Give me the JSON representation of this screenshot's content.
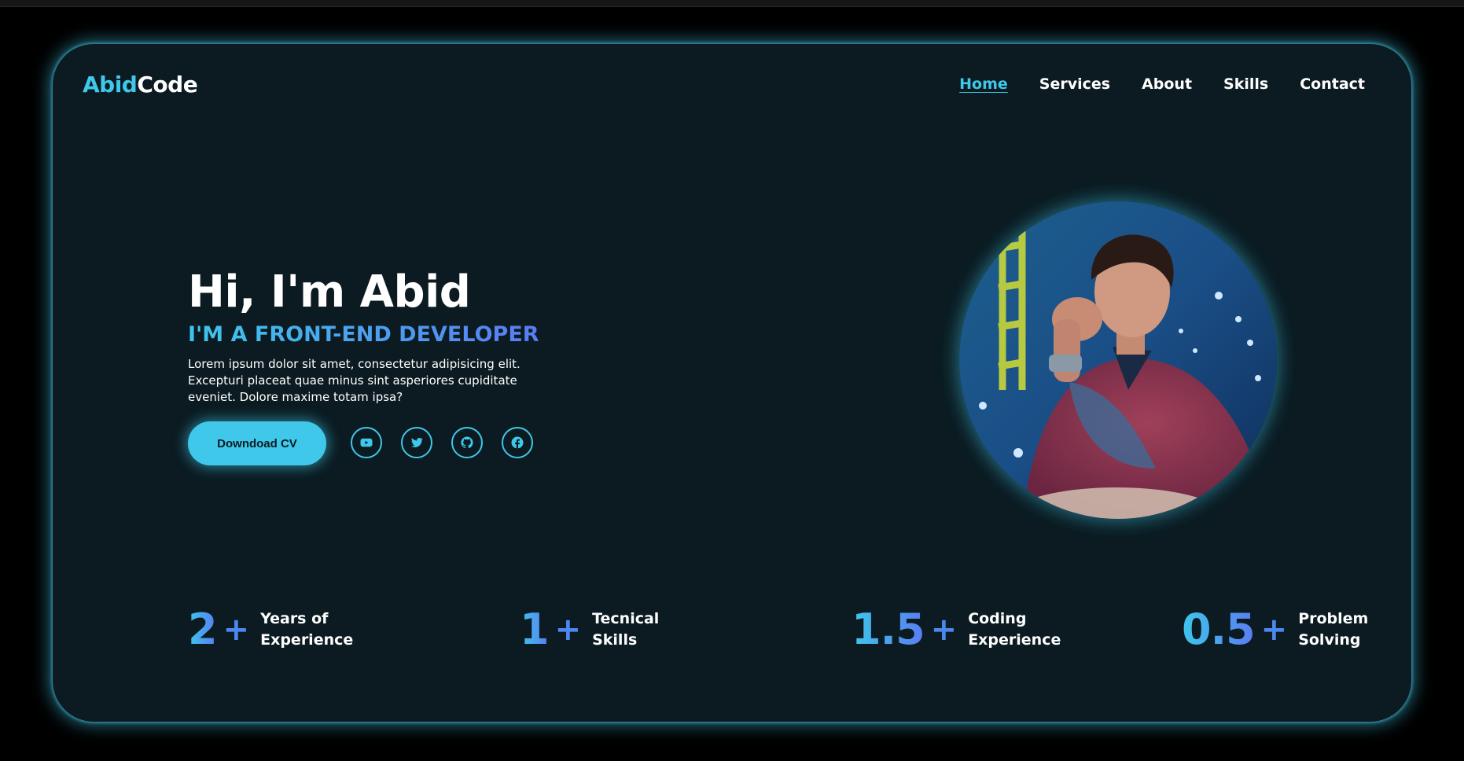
{
  "header": {
    "logo_part1": "Abid",
    "logo_part2": "Code",
    "nav": [
      {
        "label": "Home",
        "active": true
      },
      {
        "label": "Services",
        "active": false
      },
      {
        "label": "About",
        "active": false
      },
      {
        "label": "Skills",
        "active": false
      },
      {
        "label": "Contact",
        "active": false
      }
    ]
  },
  "hero": {
    "title": "Hi, I'm Abid",
    "subtitle": "I'M A FRONT-END DEVELOPER",
    "description": "Lorem ipsum dolor sit amet, consectetur adipisicing elit. Excepturi placeat quae minus sint asperiores cupiditate eveniet. Dolore maxime totam ipsa?",
    "cv_button": "Downdoad CV",
    "socials": [
      "youtube-icon",
      "twitter-icon",
      "github-icon",
      "facebook-icon"
    ]
  },
  "stats": [
    {
      "value": "2",
      "plus": "+",
      "line1": "Years of",
      "line2": "Experience"
    },
    {
      "value": "1",
      "plus": "+",
      "line1": "Tecnical",
      "line2": "Skills"
    },
    {
      "value": "1.5",
      "plus": "+",
      "line1": "Coding",
      "line2": "Experience"
    },
    {
      "value": "0.5",
      "plus": "+",
      "line1": "Problem",
      "line2": "Solving"
    }
  ],
  "colors": {
    "accent": "#3fc8ea",
    "accent_gradient_end": "#5a7cf2",
    "card_background": "#0b1b21",
    "page_background": "#000000"
  }
}
